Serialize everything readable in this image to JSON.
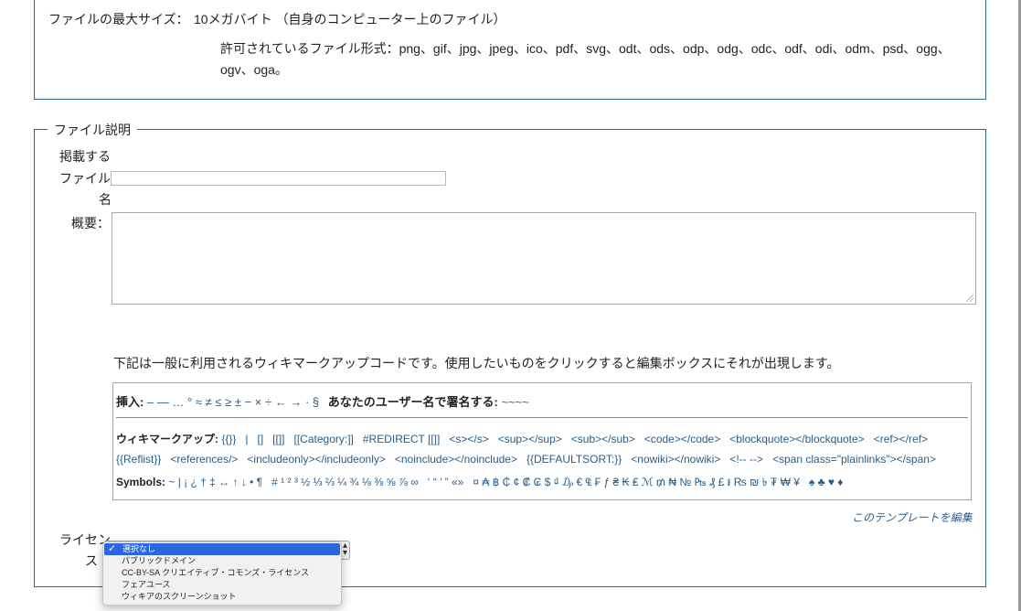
{
  "upload": {
    "max_size_label": "ファイルの最大サイズ：",
    "max_size_value": "10メガバイト （自身のコンピューター上のファイル）",
    "formats_line1": "許可されているファイル形式：png、gif、jpg、jpeg、ico、pdf、svg、odt、ods、odp、odg、odc、odf、odi、odm、psd、ogg、",
    "formats_line2": "ogv、oga。"
  },
  "description": {
    "legend": "ファイル説明",
    "filename_label_1": "掲載する",
    "filename_label_2": "ファイル",
    "filename_label_3": "名",
    "filename_value": "",
    "summary_label": "概要：",
    "summary_value": "",
    "helper_text": "下記は一般に利用されるウィキマークアップコードです。使用したいものをクリックすると編集ボックスにそれが出現します。",
    "insert_label": "挿入:",
    "insert_chars": "– — … ° ≈ ≠ ≤ ≥ ± − × ÷ ← → · §",
    "signature_label": "あなたのユーザー名で署名する:",
    "signature_code": "~~~~",
    "wikimarkup_label": "ウィキマークアップ:",
    "wikimarkup_codes_1": "{{}}   |   []   [[]]   [[Category:]]   #REDIRECT [[]]   <s></s>   <sup></sup>   <sub></sub>   <code></code>   <blockquote></blockquote>   <ref></ref>",
    "wikimarkup_codes_2": "{{Reflist}}   <references/>   <includeonly></includeonly>   <noinclude></noinclude>   {{DEFAULTSORT:}}   <nowiki></nowiki>   <!-- -->   <span class=\"plainlinks\"></span>",
    "symbols_label": "Symbols:",
    "symbols_chars": "~ | ¡ ¿ † ‡ ↔ ↑ ↓ • ¶   # ¹ ² ³ ½ ⅓ ⅔ ¼ ¾ ⅛ ⅜ ⅝ ⅞ ∞   ‘ “ ’ ” «»   ¤ ₳ ฿ ₵ ¢ ₡ ₢ $ ₫ ₯ € ₠ ₣ ƒ ₴ ₭ ₤ ℳ ₥ ₦ № ₧ ₰ £ ៛ ₨ ₪ ৳ ₮ ₩ ¥   ♠ ♣ ♥ ♦",
    "edit_template_link": "このテンプレートを編集",
    "license_label_1": "ライセン",
    "license_label_2": "ス"
  },
  "license_select": {
    "selected": "選択なし",
    "options": [
      "選択なし",
      "パブリックドメイン",
      "CC-BY-SA クリエイティブ・コモンズ・ライセンス",
      "フェアユース",
      "ウィキアのスクリーンショット"
    ]
  },
  "colors": {
    "fieldset_border": "#2a6b8c",
    "link": "#2a5c8a",
    "dropdown_highlight": "#2b66df"
  }
}
